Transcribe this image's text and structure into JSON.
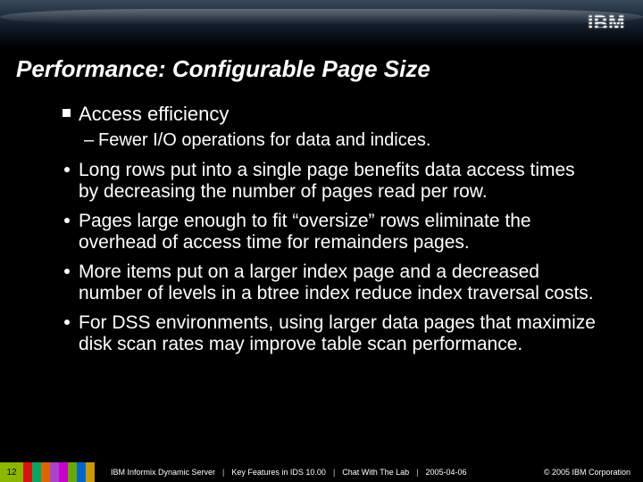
{
  "logo": "IBM",
  "title": "Performance: Configurable Page Size",
  "content": {
    "h1": "Access efficiency",
    "sub1": "Fewer I/O operations for data and indices.",
    "b1": "Long rows put into a single page benefits data access times by decreasing the number of pages read per row.",
    "b2": "Pages large enough to fit “oversize” rows eliminate the overhead of access time for remainders pages.",
    "b3": "More items put on a larger index page and a decreased number of levels in a btree index reduce index traversal costs.",
    "b4": "For DSS environments, using larger data pages that maximize disk scan rates may improve table scan performance."
  },
  "footer": {
    "page": "12",
    "product": "IBM Informix Dynamic Server",
    "deck": "Key Features in IDS 10.00",
    "series": "Chat With The Lab",
    "date": "2005-04-06",
    "copyright": "© 2005 IBM Corporation"
  }
}
